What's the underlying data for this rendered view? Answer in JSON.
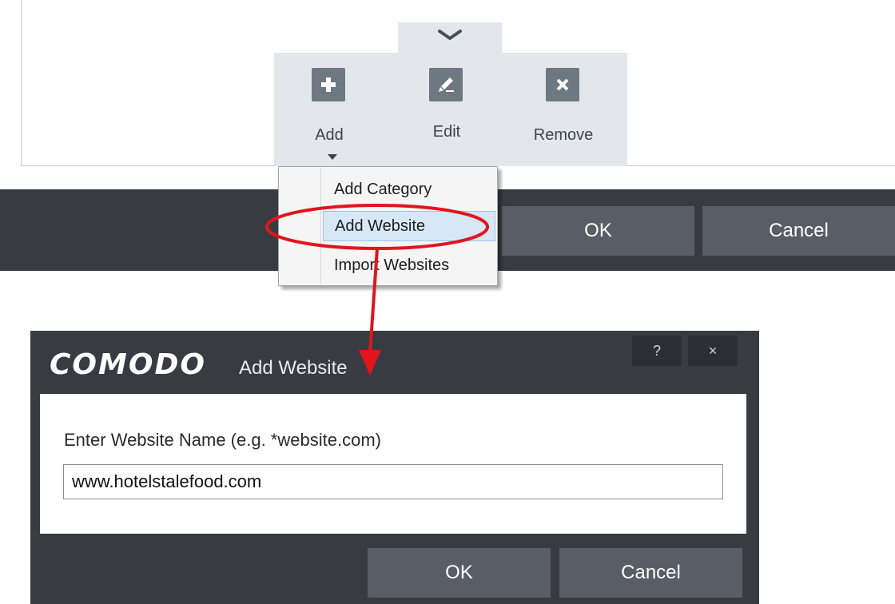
{
  "toolbar": {
    "add_label": "Add",
    "edit_label": "Edit",
    "remove_label": "Remove"
  },
  "main_bar": {
    "ok_label": "OK",
    "cancel_label": "Cancel"
  },
  "add_menu": {
    "items": [
      {
        "label": "Add Category"
      },
      {
        "label": "Add Website",
        "highlighted": true
      },
      {
        "label": "Import Websites"
      }
    ]
  },
  "dialog": {
    "brand": "COMODO",
    "title": "Add Website",
    "help_glyph": "?",
    "close_glyph": "×",
    "field_label": "Enter Website Name (e.g. *website.com)",
    "field_value": "www.hotelstalefood.com",
    "ok_label": "OK",
    "cancel_label": "Cancel"
  },
  "colors": {
    "dark_bg": "#383c42",
    "button_bg": "#585d66",
    "toolbar_bg": "#e3e7ec",
    "annotation_red": "#e0161c",
    "highlight_bg": "#d8e7f6"
  },
  "icons": [
    "chevron-down-icon",
    "plus-icon",
    "pencil-icon",
    "x-icon",
    "caret-down-icon",
    "help-icon",
    "close-icon"
  ]
}
